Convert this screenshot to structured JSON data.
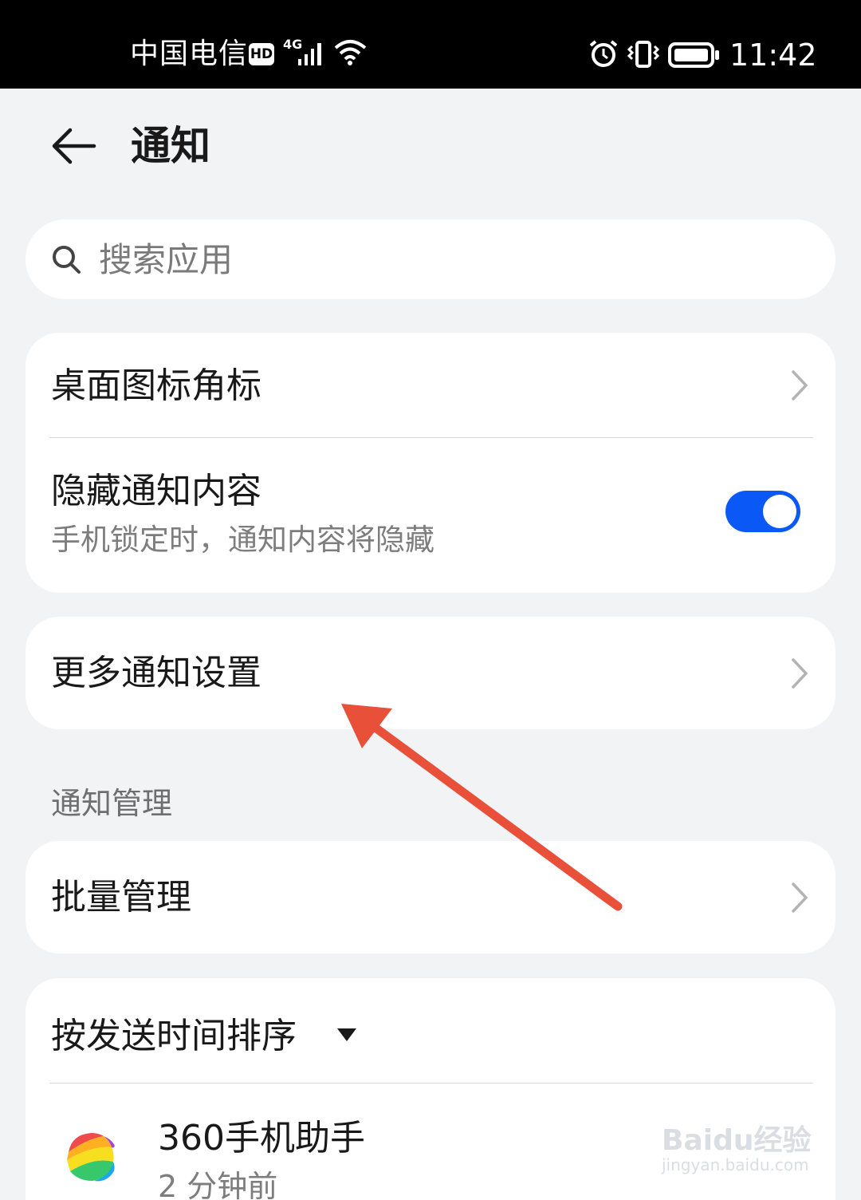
{
  "status_bar": {
    "carrier": "中国电信",
    "hd_badge": "HD",
    "network_type": "4G",
    "time": "11:42"
  },
  "header": {
    "title": "通知"
  },
  "search": {
    "placeholder": "搜索应用"
  },
  "settings_card": {
    "badge_label": "桌面图标角标",
    "hide_label": "隐藏通知内容",
    "hide_sub": "手机锁定时，通知内容将隐藏",
    "hide_toggle_on": true
  },
  "more_card": {
    "label": "更多通知设置"
  },
  "notification_management": {
    "section_title": "通知管理",
    "batch_label": "批量管理"
  },
  "app_list": {
    "sort_label": "按发送时间排序",
    "apps": [
      {
        "name": "360手机助手",
        "time": "2 分钟前"
      }
    ]
  },
  "watermark": {
    "text": "Baidu经验",
    "sub": "jingyan.baidu.com"
  },
  "colors": {
    "accent": "#0a59f7",
    "annotation": "#e8503a",
    "background": "#f1f3f5"
  }
}
